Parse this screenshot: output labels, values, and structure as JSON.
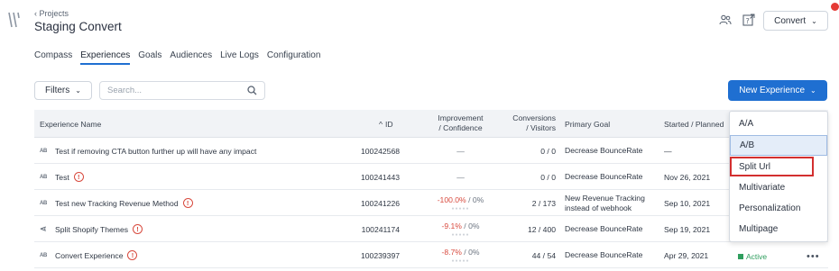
{
  "header": {
    "back_label": "‹ Projects",
    "project_title": "Staging Convert",
    "convert_button": "Convert"
  },
  "tabs": [
    "Compass",
    "Experiences",
    "Goals",
    "Audiences",
    "Live Logs",
    "Configuration"
  ],
  "active_tab": "Experiences",
  "toolbar": {
    "filters_label": "Filters",
    "search_placeholder": "Search...",
    "new_experience_label": "New Experience"
  },
  "table": {
    "columns": {
      "name": "Experience Name",
      "id": "ID",
      "improvement_line1": "Improvement",
      "improvement_line2": "/ Confidence",
      "conversions_line1": "Conversions",
      "conversions_line2": "/ Visitors",
      "goal": "Primary Goal",
      "started": "Started / Planned"
    },
    "rows": [
      {
        "type": "AB",
        "name": "Test if removing CTA button further up will have any impact",
        "warning": false,
        "id": "100242568",
        "improvement": "—",
        "confidence": "",
        "conversions": "0 / 0",
        "goal": "Decrease BounceRate",
        "started": "—"
      },
      {
        "type": "AB",
        "name": "Test",
        "warning": true,
        "id": "100241443",
        "improvement": "—",
        "confidence": "",
        "conversions": "0 / 0",
        "goal": "Decrease BounceRate",
        "started": "Nov 26, 2021"
      },
      {
        "type": "AB",
        "name": "Test new Tracking Revenue Method",
        "warning": true,
        "id": "100241226",
        "improvement": "-100.0%",
        "confidence": " / 0%",
        "conversions": "2 / 173",
        "goal": "New Revenue Tracking instead of webhook",
        "started": "Sep 10, 2021"
      },
      {
        "type": "split",
        "name": "Split Shopify Themes",
        "warning": true,
        "id": "100241174",
        "improvement": "-9.1%",
        "confidence": " / 0%",
        "conversions": "12 / 400",
        "goal": "Decrease BounceRate",
        "started": "Sep 19, 2021"
      },
      {
        "type": "AB",
        "name": "Convert Experience",
        "warning": true,
        "id": "100239397",
        "improvement": "-8.7%",
        "confidence": " / 0%",
        "conversions": "44 / 54",
        "goal": "Decrease BounceRate",
        "started": "Apr 29, 2021"
      }
    ],
    "last_row_status": "Active"
  },
  "dropdown": {
    "items": [
      "A/A",
      "A/B",
      "Split Url",
      "Multivariate",
      "Personalization",
      "Multipage"
    ],
    "highlighted": "A/B",
    "boxed": "Split Url"
  },
  "colors": {
    "accent": "#1f6fd1",
    "negative": "#d84a3e",
    "active": "#2f9e5e",
    "annotation": "#d32f2f"
  }
}
